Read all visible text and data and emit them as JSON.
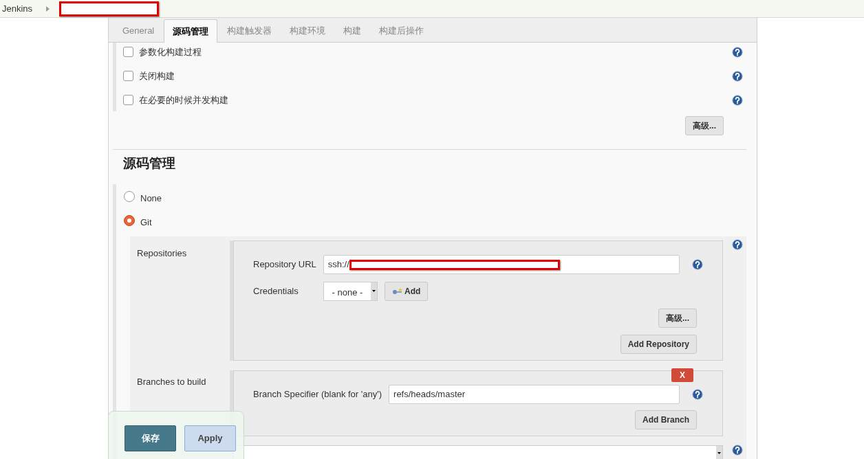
{
  "breadcrumb": {
    "root": "Jenkins"
  },
  "tabs": [
    {
      "label": "General",
      "selected": false
    },
    {
      "label": "源码管理",
      "selected": true
    },
    {
      "label": "构建触发器",
      "selected": false
    },
    {
      "label": "构建环境",
      "selected": false
    },
    {
      "label": "构建",
      "selected": false
    },
    {
      "label": "构建后操作",
      "selected": false
    }
  ],
  "general_options": [
    {
      "label": "参数化构建过程",
      "checked": false
    },
    {
      "label": "关闭构建",
      "checked": false
    },
    {
      "label": "在必要的时候并发构建",
      "checked": false
    }
  ],
  "general_advanced_button": "高级...",
  "section_title": "源码管理",
  "scm_options": [
    {
      "label": "None",
      "selected": false
    },
    {
      "label": "Git",
      "selected": true
    }
  ],
  "repositories": {
    "label": "Repositories",
    "url_label": "Repository URL",
    "url_value": "ssh://",
    "credentials_label": "Credentials",
    "credentials_value": "- none -",
    "add_button": "Add",
    "advanced_button": "高级...",
    "add_repository_button": "Add Repository"
  },
  "branches": {
    "label": "Branches to build",
    "delete_button": "X",
    "specifier_label": "Branch Specifier (blank for 'any')",
    "specifier_value": "refs/heads/master",
    "add_branch_button": "Add Branch"
  },
  "actions": [
    {
      "label": "保存",
      "kind": "primary"
    },
    {
      "label": "Apply",
      "kind": "secondary"
    }
  ]
}
